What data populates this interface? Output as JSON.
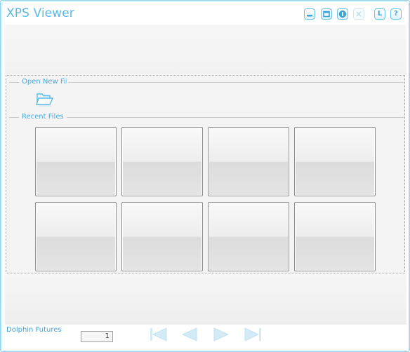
{
  "window": {
    "title": "XPS Viewer",
    "controls": [
      {
        "name": "minimize-button",
        "icon": "minimize-icon",
        "label": ""
      },
      {
        "name": "restore-button",
        "icon": "restore-icon",
        "label": ""
      },
      {
        "name": "info-button",
        "icon": "info-icon",
        "label": ""
      },
      {
        "name": "close-button",
        "icon": "close-icon",
        "label": "",
        "disabled": true
      },
      {
        "name": "language-button",
        "icon": "l-icon",
        "label": "L"
      },
      {
        "name": "help-button",
        "icon": "help-icon",
        "label": "?"
      }
    ]
  },
  "content": {
    "open_group_label": "Open New File",
    "recent_group_label": "Recent Files",
    "open_icon": "folder-open-icon",
    "recent_tiles": [
      {
        "label": ""
      },
      {
        "label": ""
      },
      {
        "label": ""
      },
      {
        "label": ""
      },
      {
        "label": ""
      },
      {
        "label": ""
      },
      {
        "label": ""
      },
      {
        "label": ""
      }
    ]
  },
  "status": {
    "brand": "Dolphin Futures",
    "page_number": "1"
  },
  "navigation": [
    {
      "name": "first-page-button",
      "icon": "first-page-icon"
    },
    {
      "name": "previous-page-button",
      "icon": "previous-page-icon"
    },
    {
      "name": "next-page-button",
      "icon": "next-page-icon"
    },
    {
      "name": "last-page-button",
      "icon": "last-page-icon"
    }
  ],
  "colors": {
    "accent": "#5ab8e2",
    "border": "#8fd0ec",
    "nav_disabled": "#cfe8f4"
  }
}
